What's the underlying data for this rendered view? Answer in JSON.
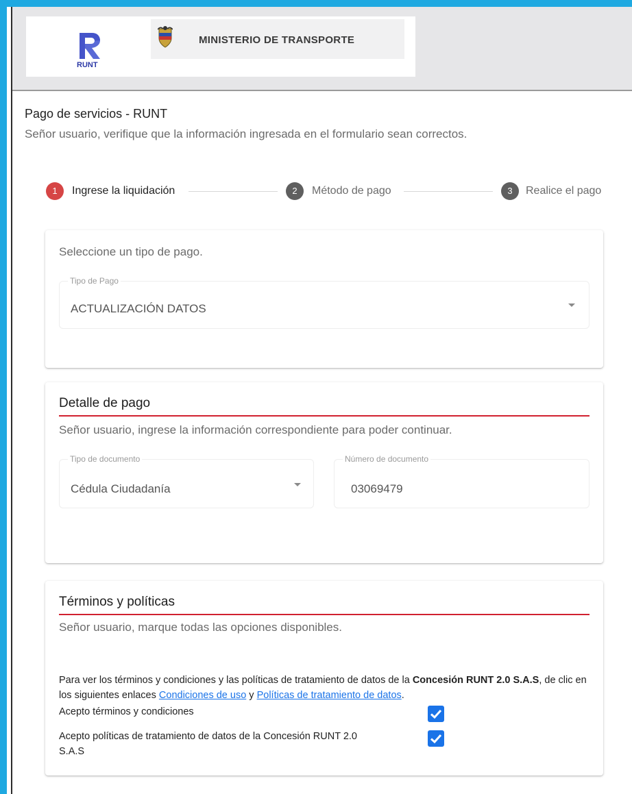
{
  "header": {
    "logo_text": "RUNT",
    "ministry": "MINISTERIO DE TRANSPORTE"
  },
  "page": {
    "title": "Pago de servicios - RUNT",
    "subtitle": "Señor usuario, verifique que la información ingresada en el formulario sean correctos."
  },
  "stepper": {
    "steps": [
      {
        "number": "1",
        "label": "Ingrese la liquidación",
        "active": true
      },
      {
        "number": "2",
        "label": "Método de pago",
        "active": false
      },
      {
        "number": "3",
        "label": "Realice el pago",
        "active": false
      }
    ]
  },
  "payment_type": {
    "hint": "Seleccione un tipo de pago.",
    "label": "Tipo de Pago",
    "value": "ACTUALIZACIÓN DATOS"
  },
  "payment_detail": {
    "title": "Detalle de pago",
    "hint": "Señor usuario, ingrese la información correspondiente para poder continuar.",
    "doc_type_label": "Tipo de documento",
    "doc_type_value": "Cédula Ciudadanía",
    "doc_number_label": "Número de documento",
    "doc_number_value": "03069479"
  },
  "terms": {
    "title": "Términos y políticas",
    "hint": "Señor usuario, marque todas las opciones disponibles.",
    "text_before": "Para ver los términos y condiciones y las políticas de tratamiento de datos de la ",
    "company_bold": "Concesión RUNT 2.0 S.A.S",
    "text_middle": ", de clic en los siguientes enlaces ",
    "link_conditions": "Condiciones de uso",
    "text_and": " y ",
    "link_policies": "Políticas de tratamiento de datos",
    "text_end": ".",
    "check1_label": "Acepto términos y condiciones",
    "check1_checked": true,
    "check2_label_line1": "Acepto políticas de tratamiento de datos de la Concesión RUNT 2.0",
    "check2_label_line2": "S.A.S",
    "check2_checked": true
  },
  "colors": {
    "frame": "#1fa9e1",
    "step_active": "#d64545",
    "step_inactive": "#5f5f5f",
    "accent_rule": "#d1202f",
    "checkbox": "#1a73e8"
  }
}
